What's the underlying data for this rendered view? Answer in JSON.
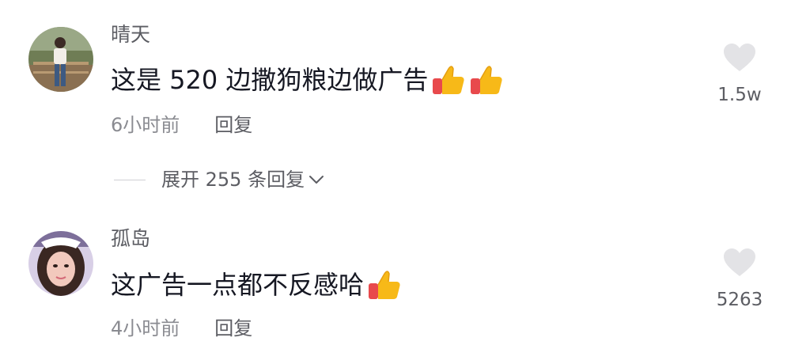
{
  "comments": [
    {
      "username": "晴天",
      "text": "这是 520 边撒狗粮边做广告",
      "emojis": [
        "thumbs-up-icon",
        "thumbs-up-icon"
      ],
      "time": "6小时前",
      "reply_label": "回复",
      "like_count": "1.5w",
      "expand_label": "展开 255 条回复"
    },
    {
      "username": "孤岛",
      "text": "这广告一点都不反感哈",
      "emojis": [
        "thumbs-up-icon"
      ],
      "time": "4小时前",
      "reply_label": "回复",
      "like_count": "5263"
    }
  ],
  "colors": {
    "text_primary": "#161823",
    "text_secondary": "#8a8b91",
    "username": "#5c5d63",
    "heart": "#e3e3e6",
    "thumb": "#f7b918",
    "cuff": "#e8494c"
  }
}
